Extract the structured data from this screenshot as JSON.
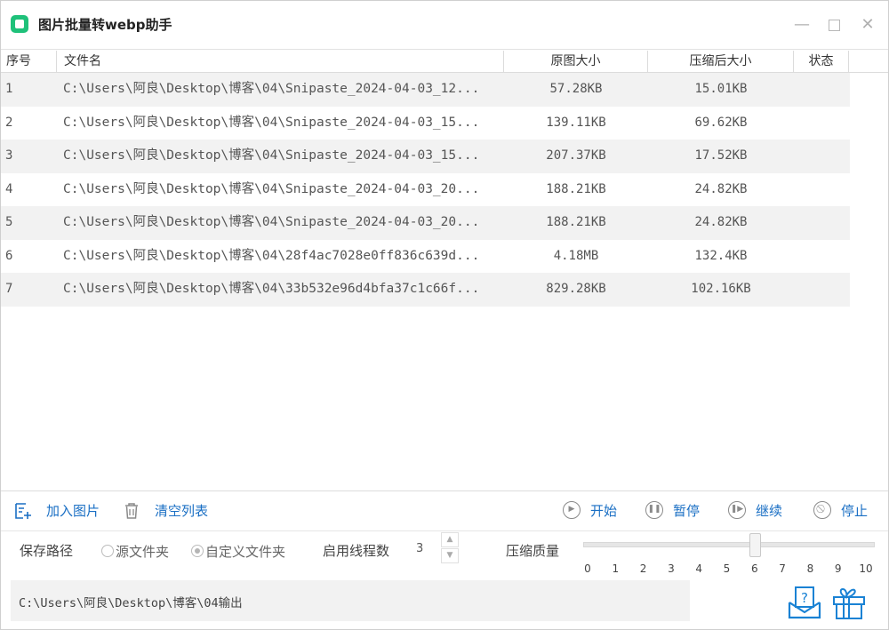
{
  "window": {
    "title": "图片批量转webp助手",
    "controls": {
      "minimize": "—",
      "close": "✕"
    }
  },
  "table": {
    "headers": {
      "index": "序号",
      "file": "文件名",
      "original_size": "原图大小",
      "compressed_size": "压缩后大小",
      "status": "状态"
    },
    "rows": [
      {
        "index": "1",
        "file": "C:\\Users\\阿良\\Desktop\\博客\\04\\Snipaste_2024-04-03_12...",
        "original_size": "57.28KB",
        "compressed_size": "15.01KB",
        "status": ""
      },
      {
        "index": "2",
        "file": "C:\\Users\\阿良\\Desktop\\博客\\04\\Snipaste_2024-04-03_15...",
        "original_size": "139.11KB",
        "compressed_size": "69.62KB",
        "status": ""
      },
      {
        "index": "3",
        "file": "C:\\Users\\阿良\\Desktop\\博客\\04\\Snipaste_2024-04-03_15...",
        "original_size": "207.37KB",
        "compressed_size": "17.52KB",
        "status": ""
      },
      {
        "index": "4",
        "file": "C:\\Users\\阿良\\Desktop\\博客\\04\\Snipaste_2024-04-03_20...",
        "original_size": "188.21KB",
        "compressed_size": "24.82KB",
        "status": ""
      },
      {
        "index": "5",
        "file": "C:\\Users\\阿良\\Desktop\\博客\\04\\Snipaste_2024-04-03_20...",
        "original_size": "188.21KB",
        "compressed_size": "24.82KB",
        "status": ""
      },
      {
        "index": "6",
        "file": "C:\\Users\\阿良\\Desktop\\博客\\04\\28f4ac7028e0ff836c639d...",
        "original_size": "4.18MB",
        "compressed_size": "132.4KB",
        "status": ""
      },
      {
        "index": "7",
        "file": "C:\\Users\\阿良\\Desktop\\博客\\04\\33b532e96d4bfa37c1c66f...",
        "original_size": "829.28KB",
        "compressed_size": "102.16KB",
        "status": ""
      }
    ]
  },
  "toolbar": {
    "add_images": "加入图片",
    "clear_list": "清空列表",
    "start": "开始",
    "pause": "暂停",
    "resume": "继续",
    "stop": "停止",
    "accent_color": "#1a6fc4"
  },
  "options": {
    "save_path_label": "保存路径",
    "source_folder": "源文件夹",
    "custom_folder": "自定义文件夹",
    "selected": "custom",
    "threads_label": "启用线程数",
    "threads_value": "3",
    "quality_label": "压缩质量",
    "quality_ticks": [
      "0",
      "1",
      "2",
      "3",
      "4",
      "5",
      "6",
      "7",
      "8",
      "9",
      "10"
    ],
    "quality_value": 6
  },
  "output_path": "C:\\Users\\阿良\\Desktop\\博客\\04输出",
  "icons": {
    "app": "app-square-icon",
    "help": "help-inbox-icon",
    "gift": "gift-icon"
  }
}
